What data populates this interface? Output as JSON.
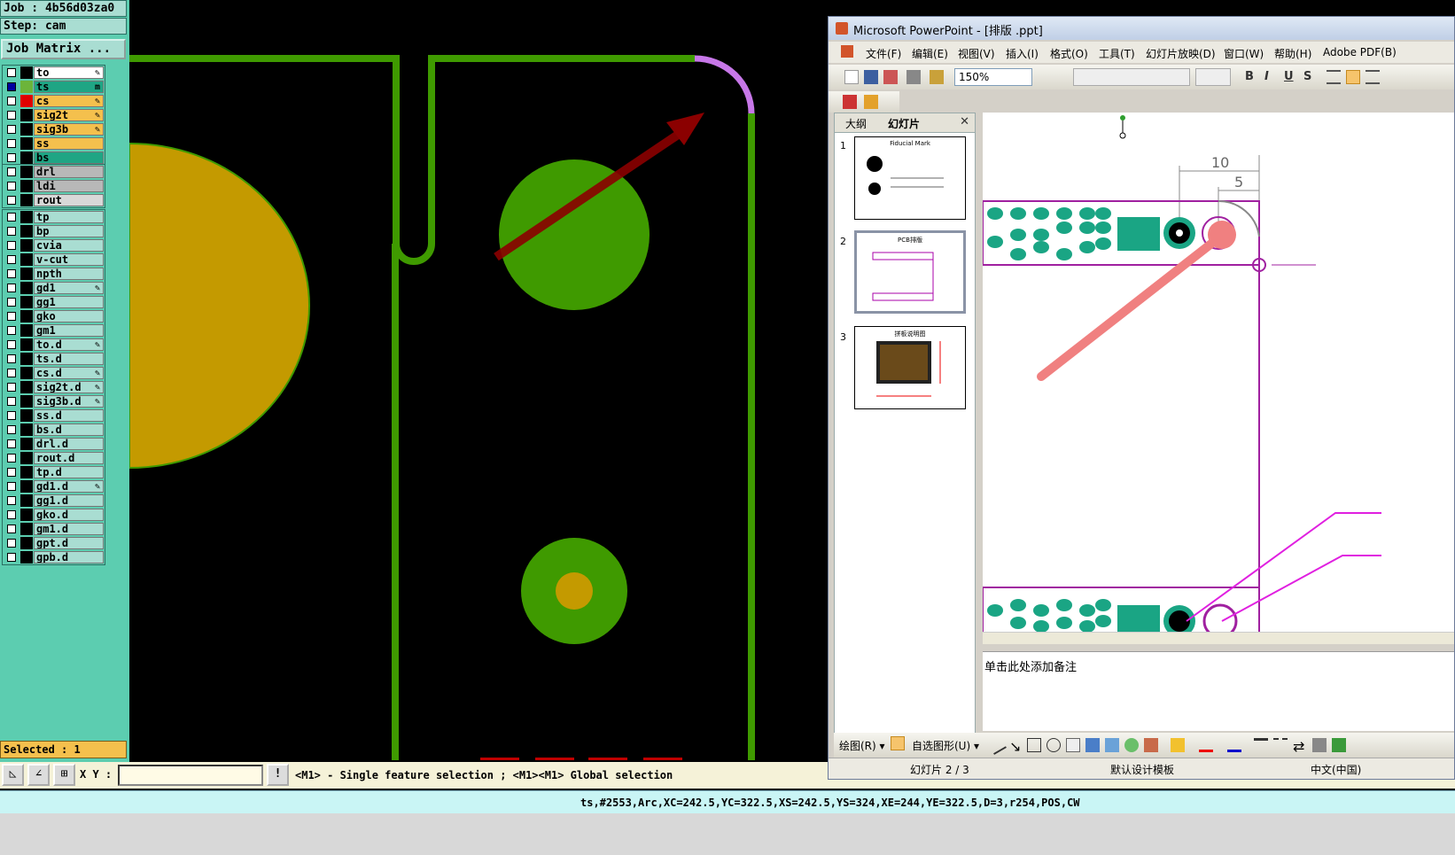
{
  "genesis": {
    "job_label": "Job : 4b56d03za0",
    "step_label": "Step: cam",
    "job_matrix_button": "Job Matrix ...",
    "layer_groups": [
      [
        {
          "name": "to",
          "color": "#ffffff",
          "checked": false,
          "mark": "✎"
        },
        {
          "name": "ts",
          "color": "#1fa584",
          "checked": true,
          "mark": "m",
          "active": true
        },
        {
          "name": "cs",
          "color": "#f4c04d",
          "checked": false,
          "mark": "✎",
          "swatch": "#e00000"
        },
        {
          "name": "sig2t",
          "color": "#f4c04d",
          "checked": false,
          "mark": "✎"
        },
        {
          "name": "sig3b",
          "color": "#f4c04d",
          "checked": false,
          "mark": "✎"
        },
        {
          "name": "ss",
          "color": "#f4c04d",
          "checked": false,
          "mark": ""
        },
        {
          "name": "bs",
          "color": "#1fa584",
          "checked": false,
          "mark": ""
        }
      ],
      [
        {
          "name": "drl",
          "color": "#b8b8b8",
          "checked": false,
          "mark": ""
        },
        {
          "name": "ldi",
          "color": "#b8b8b8",
          "checked": false,
          "mark": ""
        },
        {
          "name": "rout",
          "color": "#d8d8d8",
          "checked": false,
          "mark": ""
        }
      ],
      [
        {
          "name": "tp",
          "color": "#a9ddd2",
          "checked": false,
          "mark": ""
        },
        {
          "name": "bp",
          "color": "#a9ddd2",
          "checked": false,
          "mark": ""
        },
        {
          "name": "cvia",
          "color": "#a9ddd2",
          "checked": false,
          "mark": ""
        },
        {
          "name": "v-cut",
          "color": "#a9ddd2",
          "checked": false,
          "mark": ""
        },
        {
          "name": "npth",
          "color": "#a9ddd2",
          "checked": false,
          "mark": ""
        },
        {
          "name": "gd1",
          "color": "#a9ddd2",
          "checked": false,
          "mark": "✎"
        },
        {
          "name": "gg1",
          "color": "#a9ddd2",
          "checked": false,
          "mark": ""
        },
        {
          "name": "gko",
          "color": "#a9ddd2",
          "checked": false,
          "mark": ""
        },
        {
          "name": "gm1",
          "color": "#a9ddd2",
          "checked": false,
          "mark": ""
        },
        {
          "name": "to.d",
          "color": "#a9ddd2",
          "checked": false,
          "mark": "✎"
        },
        {
          "name": "ts.d",
          "color": "#a9ddd2",
          "checked": false,
          "mark": ""
        },
        {
          "name": "cs.d",
          "color": "#a9ddd2",
          "checked": false,
          "mark": "✎"
        },
        {
          "name": "sig2t.d",
          "color": "#a9ddd2",
          "checked": false,
          "mark": "✎"
        },
        {
          "name": "sig3b.d",
          "color": "#a9ddd2",
          "checked": false,
          "mark": "✎"
        },
        {
          "name": "ss.d",
          "color": "#a9ddd2",
          "checked": false,
          "mark": ""
        },
        {
          "name": "bs.d",
          "color": "#a9ddd2",
          "checked": false,
          "mark": ""
        },
        {
          "name": "drl.d",
          "color": "#a9ddd2",
          "checked": false,
          "mark": ""
        },
        {
          "name": "rout.d",
          "color": "#a9ddd2",
          "checked": false,
          "mark": ""
        },
        {
          "name": "tp.d",
          "color": "#a9ddd2",
          "checked": false,
          "mark": ""
        },
        {
          "name": "gd1.d",
          "color": "#a9ddd2",
          "checked": false,
          "mark": "✎"
        },
        {
          "name": "gg1.d",
          "color": "#a9ddd2",
          "checked": false,
          "mark": ""
        },
        {
          "name": "gko.d",
          "color": "#a9ddd2",
          "checked": false,
          "mark": ""
        },
        {
          "name": "gm1.d",
          "color": "#a9ddd2",
          "checked": false,
          "mark": ""
        },
        {
          "name": "gpt.d",
          "color": "#a9ddd2",
          "checked": false,
          "mark": ""
        },
        {
          "name": "gpb.d",
          "color": "#a9ddd2",
          "checked": false,
          "mark": ""
        }
      ]
    ],
    "selected_label": "Selected : 1",
    "xy_label": "X Y :",
    "xy_value": "",
    "command_hint": "<M1> - Single feature selection ; <M1><M1> Global selection",
    "status_line": "ts,#2553,Arc,XC=242.5,YC=322.5,XS=242.5,YS=324,XE=244,YE=322.5,D=3,r254,POS,CW",
    "colors": {
      "panel_bg": "#5ccdb0",
      "feature_green": "#3f9a00",
      "pad_gold": "#c49a00",
      "selected_arc": "#c777e8",
      "arrow": "#8b0000"
    }
  },
  "powerpoint": {
    "title": "Microsoft PowerPoint - [排版 .ppt]",
    "menu": [
      "文件(F)",
      "编辑(E)",
      "视图(V)",
      "插入(I)",
      "格式(O)",
      "工具(T)",
      "幻灯片放映(D)",
      "窗口(W)",
      "帮助(H)",
      "Adobe PDF(B)"
    ],
    "zoom": "150%",
    "format_buttons": [
      "B",
      "I",
      "U",
      "S"
    ],
    "pane_tabs": [
      "大纲",
      "幻灯片"
    ],
    "close_glyph": "✕",
    "slides": [
      {
        "num": "1",
        "title": "Fiducial Mark"
      },
      {
        "num": "2",
        "title": "PCB排版"
      },
      {
        "num": "3",
        "title": "拼板说明图"
      }
    ],
    "slide_dims": {
      "top": "10",
      "right": "5"
    },
    "notes_placeholder": "单击此处添加备注",
    "draw_label": "绘图(R) ▾",
    "autoshapes_label": "自选图形(U) ▾",
    "status": {
      "slide": "幻灯片 2 / 3",
      "template": "默认设计模板",
      "language": "中文(中国)"
    }
  }
}
